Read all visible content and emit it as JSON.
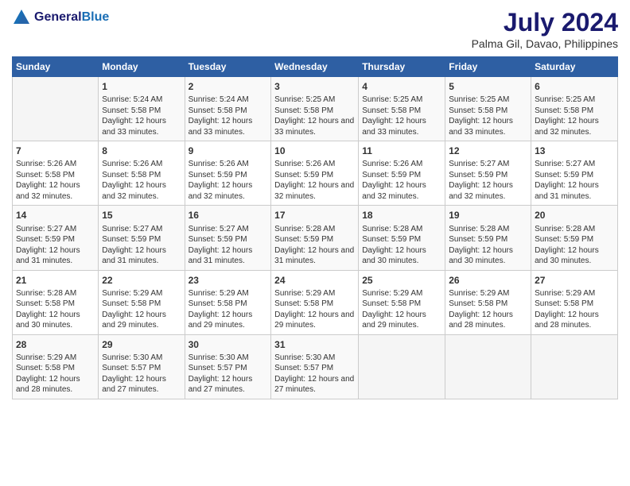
{
  "header": {
    "logo_line1": "General",
    "logo_line2": "Blue",
    "month_year": "July 2024",
    "location": "Palma Gil, Davao, Philippines"
  },
  "days_of_week": [
    "Sunday",
    "Monday",
    "Tuesday",
    "Wednesday",
    "Thursday",
    "Friday",
    "Saturday"
  ],
  "weeks": [
    [
      {
        "day": "",
        "sunrise": "",
        "sunset": "",
        "daylight": ""
      },
      {
        "day": "1",
        "sunrise": "Sunrise: 5:24 AM",
        "sunset": "Sunset: 5:58 PM",
        "daylight": "Daylight: 12 hours and 33 minutes."
      },
      {
        "day": "2",
        "sunrise": "Sunrise: 5:24 AM",
        "sunset": "Sunset: 5:58 PM",
        "daylight": "Daylight: 12 hours and 33 minutes."
      },
      {
        "day": "3",
        "sunrise": "Sunrise: 5:25 AM",
        "sunset": "Sunset: 5:58 PM",
        "daylight": "Daylight: 12 hours and 33 minutes."
      },
      {
        "day": "4",
        "sunrise": "Sunrise: 5:25 AM",
        "sunset": "Sunset: 5:58 PM",
        "daylight": "Daylight: 12 hours and 33 minutes."
      },
      {
        "day": "5",
        "sunrise": "Sunrise: 5:25 AM",
        "sunset": "Sunset: 5:58 PM",
        "daylight": "Daylight: 12 hours and 33 minutes."
      },
      {
        "day": "6",
        "sunrise": "Sunrise: 5:25 AM",
        "sunset": "Sunset: 5:58 PM",
        "daylight": "Daylight: 12 hours and 32 minutes."
      }
    ],
    [
      {
        "day": "7",
        "sunrise": "Sunrise: 5:26 AM",
        "sunset": "Sunset: 5:58 PM",
        "daylight": "Daylight: 12 hours and 32 minutes."
      },
      {
        "day": "8",
        "sunrise": "Sunrise: 5:26 AM",
        "sunset": "Sunset: 5:58 PM",
        "daylight": "Daylight: 12 hours and 32 minutes."
      },
      {
        "day": "9",
        "sunrise": "Sunrise: 5:26 AM",
        "sunset": "Sunset: 5:59 PM",
        "daylight": "Daylight: 12 hours and 32 minutes."
      },
      {
        "day": "10",
        "sunrise": "Sunrise: 5:26 AM",
        "sunset": "Sunset: 5:59 PM",
        "daylight": "Daylight: 12 hours and 32 minutes."
      },
      {
        "day": "11",
        "sunrise": "Sunrise: 5:26 AM",
        "sunset": "Sunset: 5:59 PM",
        "daylight": "Daylight: 12 hours and 32 minutes."
      },
      {
        "day": "12",
        "sunrise": "Sunrise: 5:27 AM",
        "sunset": "Sunset: 5:59 PM",
        "daylight": "Daylight: 12 hours and 32 minutes."
      },
      {
        "day": "13",
        "sunrise": "Sunrise: 5:27 AM",
        "sunset": "Sunset: 5:59 PM",
        "daylight": "Daylight: 12 hours and 31 minutes."
      }
    ],
    [
      {
        "day": "14",
        "sunrise": "Sunrise: 5:27 AM",
        "sunset": "Sunset: 5:59 PM",
        "daylight": "Daylight: 12 hours and 31 minutes."
      },
      {
        "day": "15",
        "sunrise": "Sunrise: 5:27 AM",
        "sunset": "Sunset: 5:59 PM",
        "daylight": "Daylight: 12 hours and 31 minutes."
      },
      {
        "day": "16",
        "sunrise": "Sunrise: 5:27 AM",
        "sunset": "Sunset: 5:59 PM",
        "daylight": "Daylight: 12 hours and 31 minutes."
      },
      {
        "day": "17",
        "sunrise": "Sunrise: 5:28 AM",
        "sunset": "Sunset: 5:59 PM",
        "daylight": "Daylight: 12 hours and 31 minutes."
      },
      {
        "day": "18",
        "sunrise": "Sunrise: 5:28 AM",
        "sunset": "Sunset: 5:59 PM",
        "daylight": "Daylight: 12 hours and 30 minutes."
      },
      {
        "day": "19",
        "sunrise": "Sunrise: 5:28 AM",
        "sunset": "Sunset: 5:59 PM",
        "daylight": "Daylight: 12 hours and 30 minutes."
      },
      {
        "day": "20",
        "sunrise": "Sunrise: 5:28 AM",
        "sunset": "Sunset: 5:59 PM",
        "daylight": "Daylight: 12 hours and 30 minutes."
      }
    ],
    [
      {
        "day": "21",
        "sunrise": "Sunrise: 5:28 AM",
        "sunset": "Sunset: 5:58 PM",
        "daylight": "Daylight: 12 hours and 30 minutes."
      },
      {
        "day": "22",
        "sunrise": "Sunrise: 5:29 AM",
        "sunset": "Sunset: 5:58 PM",
        "daylight": "Daylight: 12 hours and 29 minutes."
      },
      {
        "day": "23",
        "sunrise": "Sunrise: 5:29 AM",
        "sunset": "Sunset: 5:58 PM",
        "daylight": "Daylight: 12 hours and 29 minutes."
      },
      {
        "day": "24",
        "sunrise": "Sunrise: 5:29 AM",
        "sunset": "Sunset: 5:58 PM",
        "daylight": "Daylight: 12 hours and 29 minutes."
      },
      {
        "day": "25",
        "sunrise": "Sunrise: 5:29 AM",
        "sunset": "Sunset: 5:58 PM",
        "daylight": "Daylight: 12 hours and 29 minutes."
      },
      {
        "day": "26",
        "sunrise": "Sunrise: 5:29 AM",
        "sunset": "Sunset: 5:58 PM",
        "daylight": "Daylight: 12 hours and 28 minutes."
      },
      {
        "day": "27",
        "sunrise": "Sunrise: 5:29 AM",
        "sunset": "Sunset: 5:58 PM",
        "daylight": "Daylight: 12 hours and 28 minutes."
      }
    ],
    [
      {
        "day": "28",
        "sunrise": "Sunrise: 5:29 AM",
        "sunset": "Sunset: 5:58 PM",
        "daylight": "Daylight: 12 hours and 28 minutes."
      },
      {
        "day": "29",
        "sunrise": "Sunrise: 5:30 AM",
        "sunset": "Sunset: 5:57 PM",
        "daylight": "Daylight: 12 hours and 27 minutes."
      },
      {
        "day": "30",
        "sunrise": "Sunrise: 5:30 AM",
        "sunset": "Sunset: 5:57 PM",
        "daylight": "Daylight: 12 hours and 27 minutes."
      },
      {
        "day": "31",
        "sunrise": "Sunrise: 5:30 AM",
        "sunset": "Sunset: 5:57 PM",
        "daylight": "Daylight: 12 hours and 27 minutes."
      },
      {
        "day": "",
        "sunrise": "",
        "sunset": "",
        "daylight": ""
      },
      {
        "day": "",
        "sunrise": "",
        "sunset": "",
        "daylight": ""
      },
      {
        "day": "",
        "sunrise": "",
        "sunset": "",
        "daylight": ""
      }
    ]
  ]
}
